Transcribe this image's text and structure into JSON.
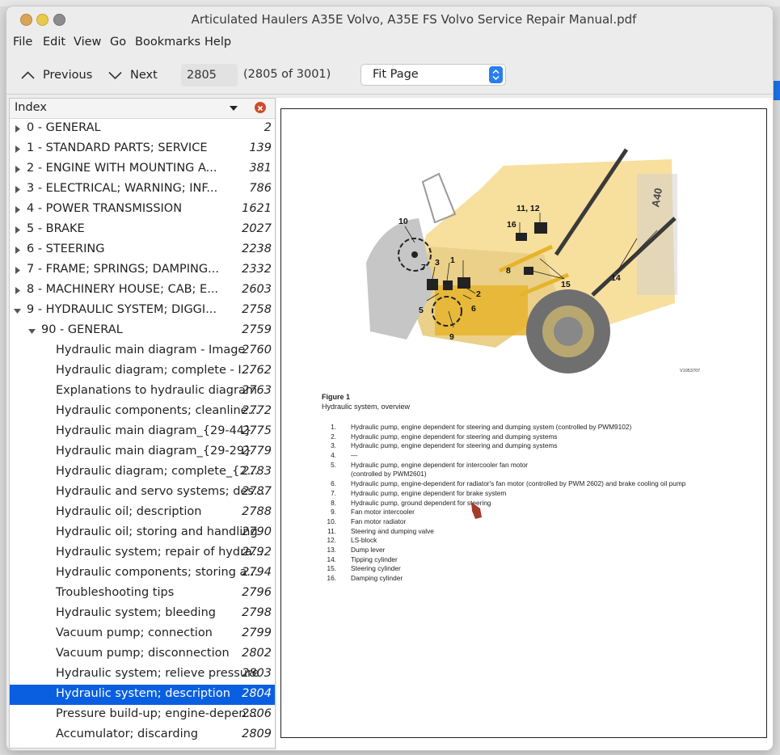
{
  "window": {
    "title": "Articulated Haulers A35E Volvo, A35E FS Volvo Service Repair Manual.pdf"
  },
  "menu": [
    "File",
    "Edit",
    "View",
    "Go",
    "Bookmarks",
    "Help"
  ],
  "toolbar": {
    "previous": "Previous",
    "next": "Next",
    "page_value": "2805",
    "page_count": "(2805 of 3001)",
    "zoom": "Fit Page"
  },
  "sidebar": {
    "title": "Index",
    "items": [
      {
        "label": "0 - GENERAL",
        "page": "2",
        "level": 0,
        "expand": "collapsed"
      },
      {
        "label": "1 - STANDARD PARTS; SERVICE",
        "page": "139",
        "level": 0,
        "expand": "collapsed"
      },
      {
        "label": "2 - ENGINE WITH MOUNTING A...",
        "page": "381",
        "level": 0,
        "expand": "collapsed"
      },
      {
        "label": "3 - ELECTRICAL; WARNING; INF...",
        "page": "786",
        "level": 0,
        "expand": "collapsed"
      },
      {
        "label": "4 - POWER TRANSMISSION",
        "page": "1621",
        "level": 0,
        "expand": "collapsed"
      },
      {
        "label": "5 - BRAKE",
        "page": "2027",
        "level": 0,
        "expand": "collapsed"
      },
      {
        "label": "6 - STEERING",
        "page": "2238",
        "level": 0,
        "expand": "collapsed"
      },
      {
        "label": "7 - FRAME; SPRINGS; DAMPING...",
        "page": "2332",
        "level": 0,
        "expand": "collapsed"
      },
      {
        "label": "8 - MACHINERY HOUSE; CAB; E...",
        "page": "2603",
        "level": 0,
        "expand": "collapsed"
      },
      {
        "label": "9 - HYDRAULIC SYSTEM; DIGGI...",
        "page": "2758",
        "level": 0,
        "expand": "expanded"
      },
      {
        "label": "90 - GENERAL",
        "page": "2759",
        "level": 1,
        "expand": "expanded"
      },
      {
        "label": "Hydraulic main diagram - Image",
        "page": "2760",
        "level": 2,
        "expand": "none"
      },
      {
        "label": "Hydraulic diagram; complete - I...",
        "page": "2762",
        "level": 2,
        "expand": "none"
      },
      {
        "label": "Explanations to hydraulic diagram",
        "page": "2763",
        "level": 2,
        "expand": "none"
      },
      {
        "label": "Hydraulic components; cleanline...",
        "page": "2772",
        "level": 2,
        "expand": "none"
      },
      {
        "label": "Hydraulic main diagram_{29-44}",
        "page": "2775",
        "level": 2,
        "expand": "none"
      },
      {
        "label": "Hydraulic main diagram_{29-29}",
        "page": "2779",
        "level": 2,
        "expand": "none"
      },
      {
        "label": "Hydraulic diagram; complete_{2...",
        "page": "2783",
        "level": 2,
        "expand": "none"
      },
      {
        "label": "Hydraulic and servo systems; des...",
        "page": "2787",
        "level": 2,
        "expand": "none"
      },
      {
        "label": "Hydraulic oil; description",
        "page": "2788",
        "level": 2,
        "expand": "none"
      },
      {
        "label": "Hydraulic oil; storing and handling",
        "page": "2790",
        "level": 2,
        "expand": "none"
      },
      {
        "label": "Hydraulic system; repair of hydra...",
        "page": "2792",
        "level": 2,
        "expand": "none"
      },
      {
        "label": "Hydraulic components; storing a...",
        "page": "2794",
        "level": 2,
        "expand": "none"
      },
      {
        "label": "Troubleshooting tips",
        "page": "2796",
        "level": 2,
        "expand": "none"
      },
      {
        "label": "Hydraulic system; bleeding",
        "page": "2798",
        "level": 2,
        "expand": "none"
      },
      {
        "label": "Vacuum pump; connection",
        "page": "2799",
        "level": 2,
        "expand": "none"
      },
      {
        "label": "Vacuum pump; disconnection",
        "page": "2802",
        "level": 2,
        "expand": "none"
      },
      {
        "label": "Hydraulic system; relieve pressure",
        "page": "2803",
        "level": 2,
        "expand": "none"
      },
      {
        "label": "Hydraulic system; description",
        "page": "2804",
        "level": 2,
        "expand": "none",
        "selected": true
      },
      {
        "label": "Pressure build-up; engine-depen...",
        "page": "2806",
        "level": 2,
        "expand": "none"
      },
      {
        "label": "Accumulator; discarding",
        "page": "2809",
        "level": 2,
        "expand": "none"
      }
    ]
  },
  "document": {
    "figure_code": "V1053707",
    "figure_title": "Figure 1",
    "figure_subtitle": "Hydraulic system, overview",
    "callouts": [
      "10",
      "11, 12",
      "16",
      "7",
      "3",
      "1",
      "2",
      "8",
      "15",
      "14",
      "5",
      "6",
      "9"
    ],
    "legend": [
      {
        "n": "1.",
        "d": "Hydraulic pump, engine dependent for steering and dumping system (controlled by PWM9102)"
      },
      {
        "n": "2.",
        "d": "Hydraulic pump, engine dependent for steering and dumping systems"
      },
      {
        "n": "3.",
        "d": "Hydraulic pump, engine dependent for steering and dumping systems"
      },
      {
        "n": "4.",
        "d": "—"
      },
      {
        "n": "5.",
        "d": "Hydraulic pump, engine dependent for intercooler fan motor"
      },
      {
        "n": "",
        "d": "(controlled by PWM2601)"
      },
      {
        "n": "6.",
        "d": "Hydraulic pump, engine-dependent for radiator's fan motor (controlled by PWM 2602) and brake cooling oil pump"
      },
      {
        "n": "7.",
        "d": "Hydraulic pump, engine dependent for brake system"
      },
      {
        "n": "8.",
        "d": "Hydraulic pump, ground dependent for steering"
      },
      {
        "n": "9.",
        "d": "Fan motor intercooler"
      },
      {
        "n": "10.",
        "d": "Fan motor radiator"
      },
      {
        "n": "11.",
        "d": "Steering and dumping valve"
      },
      {
        "n": "12.",
        "d": "LS-block"
      },
      {
        "n": "13.",
        "d": "Dump lever"
      },
      {
        "n": "14.",
        "d": "Tipping cylinder"
      },
      {
        "n": "15.",
        "d": "Steering cylinder"
      },
      {
        "n": "16.",
        "d": "Damping cylinder"
      }
    ]
  }
}
